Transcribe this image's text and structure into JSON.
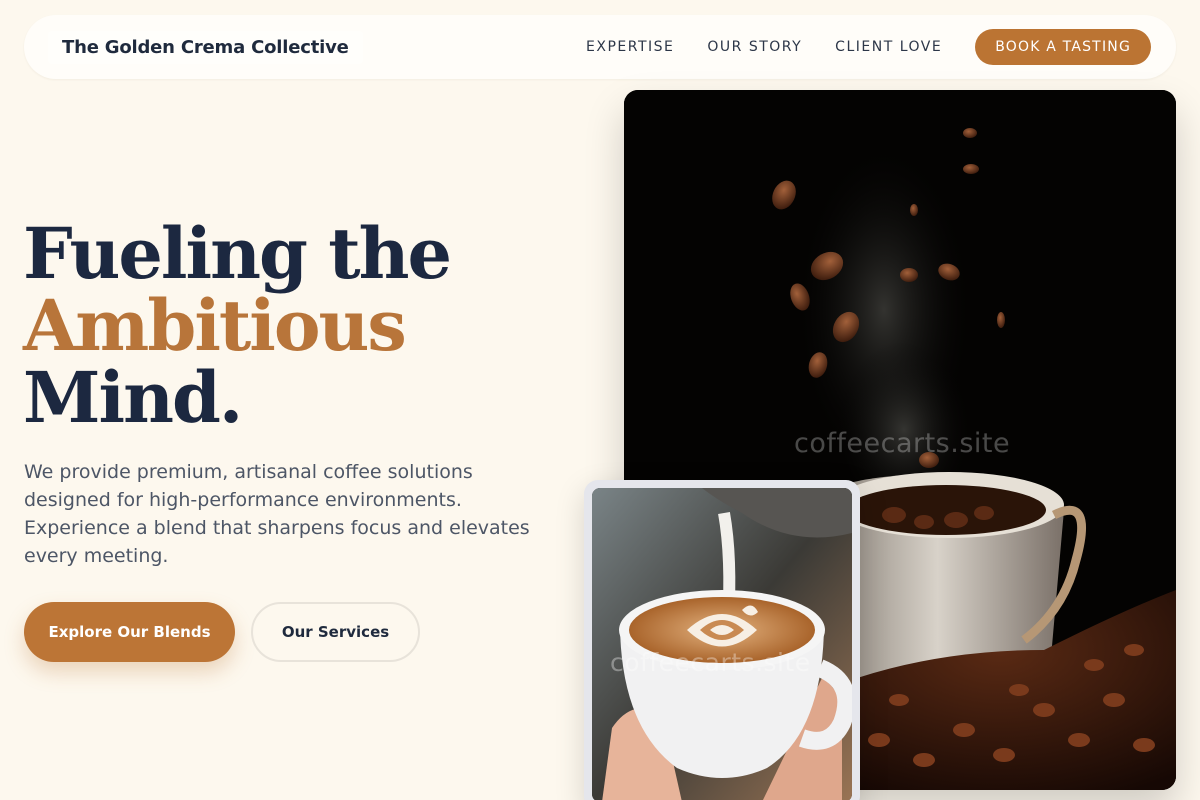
{
  "header": {
    "brand": "The Golden Crema Collective",
    "nav_links": [
      "EXPERTISE",
      "OUR STORY",
      "CLIENT LOVE"
    ],
    "cta_label": "BOOK A TASTING"
  },
  "hero": {
    "title_line1": "Fueling the",
    "title_accent": "Ambitious",
    "title_line3": "Mind.",
    "description": "We provide premium, artisanal coffee solutions designed for high-performance environments. Experience a blend that sharpens focus and elevates every meeting.",
    "primary_button": "Explore Our Blends",
    "secondary_button": "Our Services"
  },
  "images": {
    "main_watermark": "coffeecarts.site",
    "small_watermark": "coffeecarts.site",
    "main_icon": "coffee-beans-photo",
    "small_icon": "latte-art-photo"
  },
  "colors": {
    "background": "#fdf8ee",
    "accent": "#bb7433",
    "heading": "#1c2840",
    "body_text": "#4d5666"
  }
}
